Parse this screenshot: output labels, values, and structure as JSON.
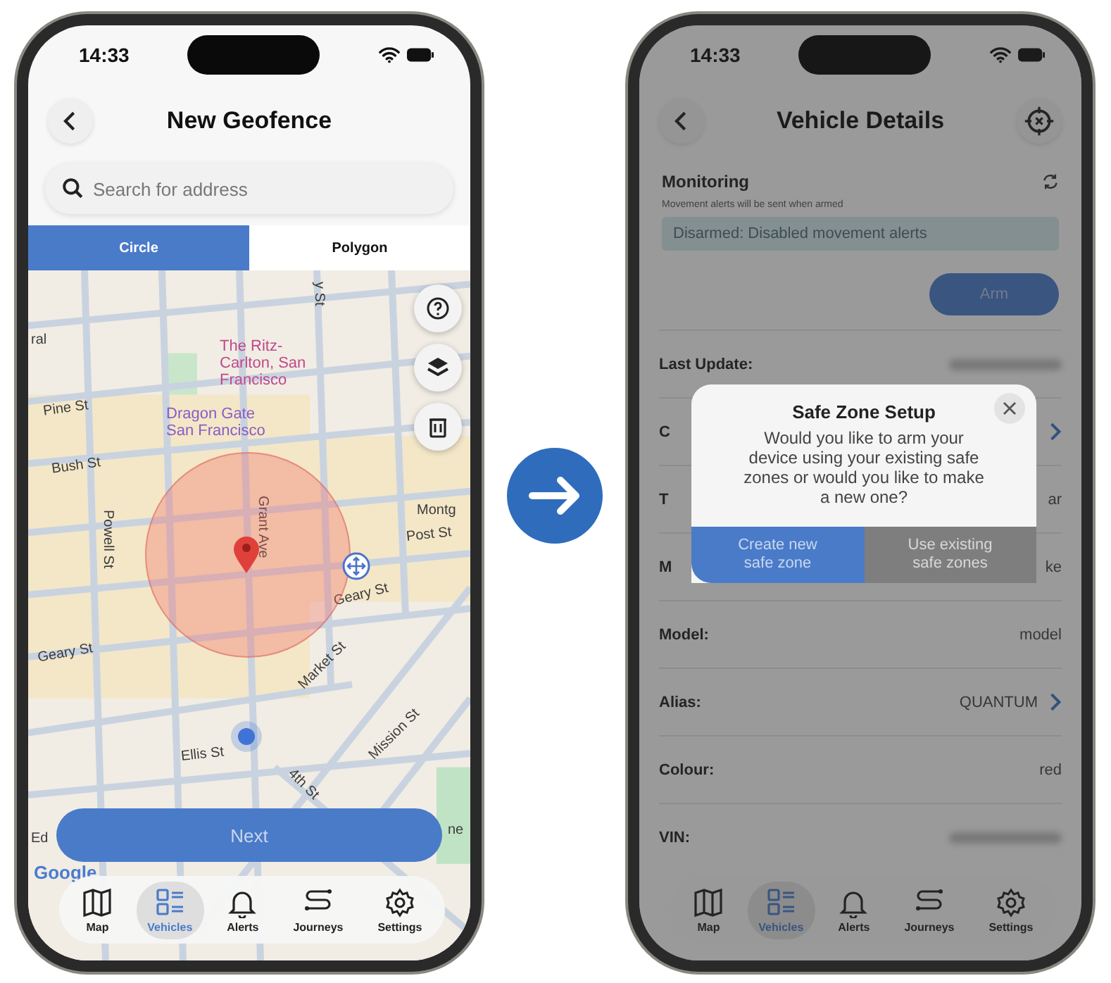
{
  "left_screen": {
    "status_bar": {
      "time": "14:33"
    },
    "title": "New Geofence",
    "search": {
      "placeholder": "Search for address"
    },
    "tabs": [
      {
        "label": "Circle",
        "selected": true
      },
      {
        "label": "Polygon",
        "selected": false
      }
    ],
    "map": {
      "labels": [
        {
          "text": "ral",
          "kind": "street"
        },
        {
          "text": "y St",
          "kind": "street"
        },
        {
          "text": "The Ritz-Carlton, San Francisco",
          "kind": "hotel"
        },
        {
          "text": "Pine St",
          "kind": "street"
        },
        {
          "text": "Dragon Gate San Francisco",
          "kind": "attraction"
        },
        {
          "text": "Bush St",
          "kind": "street"
        },
        {
          "text": "Grant Ave",
          "kind": "street"
        },
        {
          "text": "Powell St",
          "kind": "street"
        },
        {
          "text": "Montg",
          "kind": "street"
        },
        {
          "text": "Post St",
          "kind": "street"
        },
        {
          "text": "Geary St",
          "kind": "street"
        },
        {
          "text": "Geary St",
          "kind": "street"
        },
        {
          "text": "Market St",
          "kind": "street"
        },
        {
          "text": "Ellis St",
          "kind": "street"
        },
        {
          "text": "4th St",
          "kind": "street"
        },
        {
          "text": "Mission St",
          "kind": "street"
        },
        {
          "text": "Ed",
          "kind": "street"
        },
        {
          "text": "ne",
          "kind": "street"
        },
        {
          "text": "Google",
          "kind": "logo"
        }
      ]
    },
    "next_button": "Next",
    "nav": [
      {
        "label": "Map",
        "kind": "map",
        "selected": false
      },
      {
        "label": "Vehicles",
        "kind": "vehicles",
        "selected": true
      },
      {
        "label": "Alerts",
        "kind": "alerts",
        "selected": false
      },
      {
        "label": "Journeys",
        "kind": "journeys",
        "selected": false
      },
      {
        "label": "Settings",
        "kind": "settings",
        "selected": false
      }
    ]
  },
  "right_screen": {
    "status_bar": {
      "time": "14:33"
    },
    "title": "Vehicle Details",
    "monitoring": {
      "title": "Monitoring",
      "subtitle": "Movement alerts will be sent when armed",
      "status": "Disarmed: Disabled movement alerts",
      "button": "Arm"
    },
    "details": [
      {
        "label": "Last Update:",
        "kind": "blurred"
      },
      {
        "label": "C",
        "kind": "link"
      },
      {
        "label": "T",
        "value": "ar",
        "kind": "text"
      },
      {
        "label": "M",
        "value": "ke",
        "kind": "text"
      },
      {
        "label": "Model:",
        "value": "model",
        "kind": "text"
      },
      {
        "label": "Alias:",
        "value": "QUANTUM",
        "kind": "link"
      },
      {
        "label": "Colour:",
        "value": "red",
        "kind": "text"
      },
      {
        "label": "VIN:",
        "kind": "blurred"
      }
    ],
    "dialog": {
      "title": "Safe Zone Setup",
      "message": "Would you like to arm your device using your existing safe zones or would you like to make a new one?",
      "buttons": [
        {
          "label": "Create new safe zone",
          "selected": true
        },
        {
          "label": "Use existing safe zones",
          "selected": false
        }
      ]
    },
    "nav": [
      {
        "label": "Map",
        "kind": "map",
        "selected": false
      },
      {
        "label": "Vehicles",
        "kind": "vehicles",
        "selected": true
      },
      {
        "label": "Alerts",
        "kind": "alerts",
        "selected": false
      },
      {
        "label": "Journeys",
        "kind": "journeys",
        "selected": false
      },
      {
        "label": "Settings",
        "kind": "settings",
        "selected": false
      }
    ]
  }
}
